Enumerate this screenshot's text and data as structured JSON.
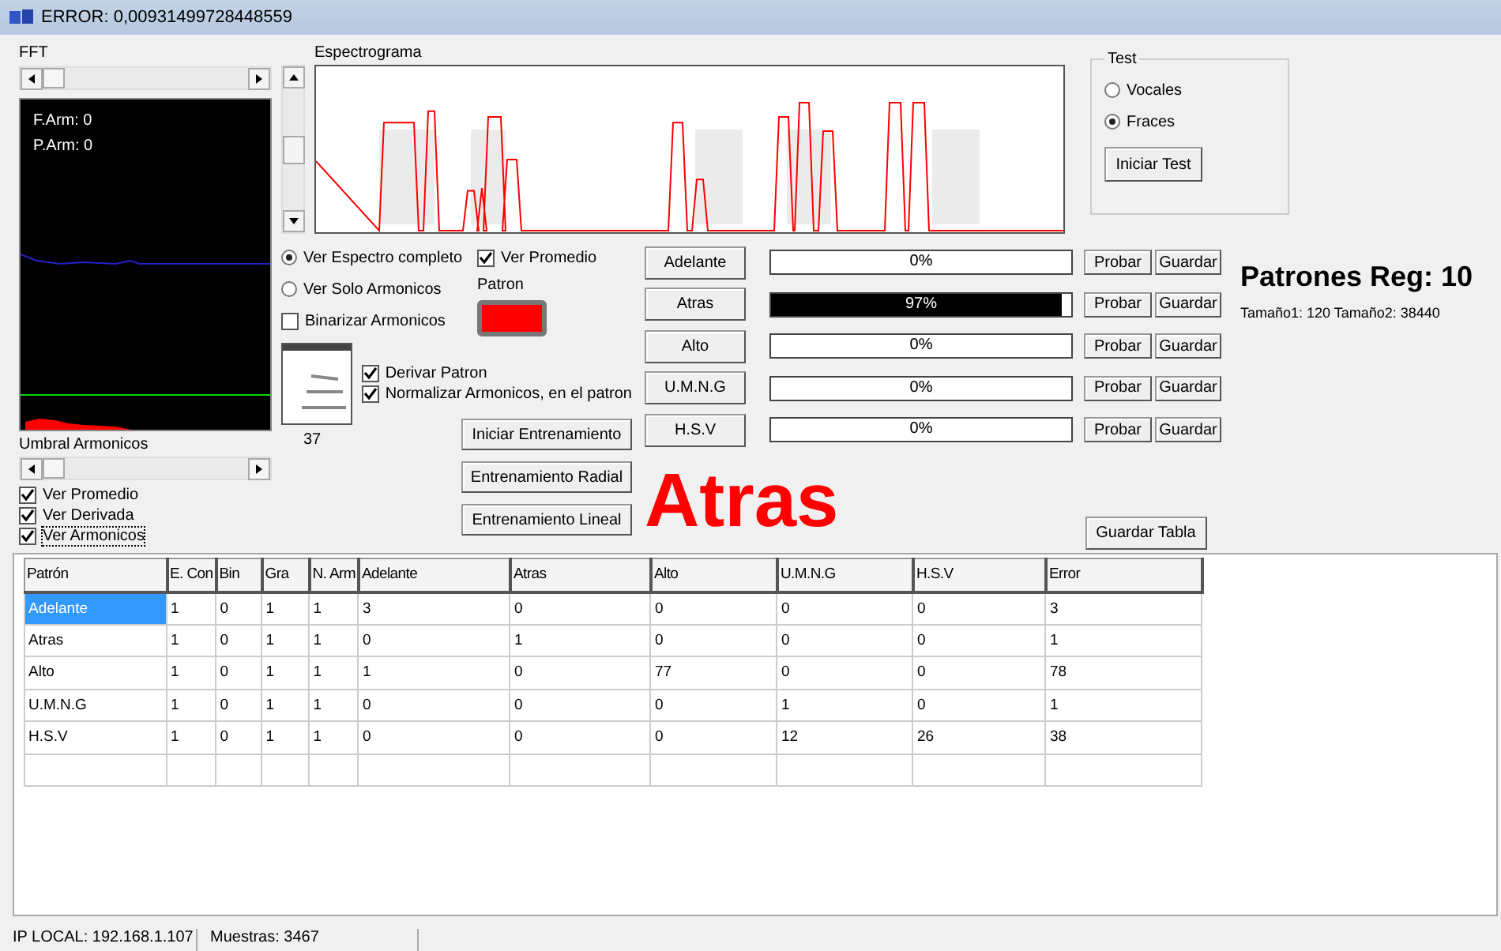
{
  "window": {
    "title": "ERROR: 0,00931499728448559"
  },
  "fft": {
    "label": "FFT",
    "readouts": [
      "F.Arm: 0",
      "P.Arm: 0"
    ]
  },
  "umbral": {
    "label": "Umbral Armonicos"
  },
  "view_checks": [
    {
      "label": "Ver Promedio",
      "checked": true,
      "focused": false
    },
    {
      "label": "Ver Derivada",
      "checked": true,
      "focused": false
    },
    {
      "label": "Ver Armonicos",
      "checked": true,
      "focused": true
    }
  ],
  "spectrogram": {
    "label": "Espectrograma"
  },
  "spectrum_mode": [
    {
      "label": "Ver Espectro completo",
      "selected": true
    },
    {
      "label": "Ver Solo Armonicos",
      "selected": false
    }
  ],
  "binarize": {
    "label": "Binarizar Armonicos",
    "checked": false
  },
  "ver_promedio": {
    "label": "Ver Promedio",
    "checked": true
  },
  "patron": {
    "label": "Patron",
    "color": "#ff0000"
  },
  "pattern_checks": [
    {
      "label": "Derivar Patron",
      "checked": true
    },
    {
      "label": "Normalizar Armonicos, en el patron",
      "checked": true
    }
  ],
  "thumbnail_count": "37",
  "training_buttons": [
    "Iniciar Entrenamiento",
    "Entrenamiento Radial",
    "Entrenamiento Lineal"
  ],
  "patterns": [
    {
      "name": "Adelante",
      "level": 0,
      "reading": "0%",
      "test": "Probar",
      "save": "Guardar"
    },
    {
      "name": "Atras",
      "level": 0.97,
      "reading": "97%",
      "test": "Probar",
      "save": "Guardar"
    },
    {
      "name": "Alto",
      "level": 0,
      "reading": "0%",
      "test": "Probar",
      "save": "Guardar"
    },
    {
      "name": "U.M.N.G",
      "level": 0,
      "reading": "0%",
      "test": "Probar",
      "save": "Guardar"
    },
    {
      "name": "H.S.V",
      "level": 0,
      "reading": "0%",
      "test": "Probar",
      "save": "Guardar"
    }
  ],
  "test": {
    "title": "Test",
    "options": [
      {
        "label": "Vocales",
        "selected": false
      },
      {
        "label": "Fraces",
        "selected": true
      }
    ],
    "button": "Iniciar Test"
  },
  "registered": {
    "title": "Patrones Reg: 10",
    "sizes": "Tamaño1: 120 Tamaño2: 38440"
  },
  "result": "Atras",
  "save_table": "Guardar Tabla",
  "table": {
    "columns": [
      "Patrón",
      "E. Con",
      "Bin",
      "Gra",
      "N. Arm",
      "Adelante",
      "Atras",
      "Alto",
      "U.M.N.G",
      "H.S.V",
      "Error"
    ],
    "rows": [
      {
        "cells": [
          "Adelante",
          "1",
          "0",
          "1",
          "1",
          "3",
          "0",
          "0",
          "0",
          "0",
          "3"
        ],
        "selected": true
      },
      {
        "cells": [
          "Atras",
          "1",
          "0",
          "1",
          "1",
          "0",
          "1",
          "0",
          "0",
          "0",
          "1"
        ],
        "selected": false
      },
      {
        "cells": [
          "Alto",
          "1",
          "0",
          "1",
          "1",
          "1",
          "0",
          "77",
          "0",
          "0",
          "78"
        ],
        "selected": false
      },
      {
        "cells": [
          "U.M.N.G",
          "1",
          "0",
          "1",
          "1",
          "0",
          "0",
          "0",
          "1",
          "0",
          "1"
        ],
        "selected": false
      },
      {
        "cells": [
          "H.S.V",
          "1",
          "0",
          "1",
          "1",
          "0",
          "0",
          "0",
          "12",
          "26",
          "38"
        ],
        "selected": false
      }
    ]
  },
  "status_bar": [
    "IP LOCAL: 192.168.1.107",
    "Muestras: 3467"
  ]
}
